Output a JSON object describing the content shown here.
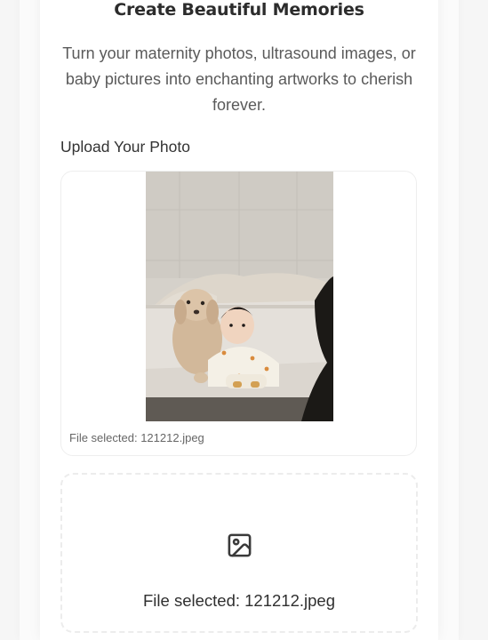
{
  "header": {
    "title": "Create Beautiful Memories",
    "subtitle": "Turn your maternity photos, ultrasound images, or baby pictures into enchanting artworks to cherish forever."
  },
  "upload": {
    "label": "Upload Your Photo",
    "preview_file_note": "File selected: 121212.jpeg",
    "dropzone_icon": "image-icon",
    "dropzone_file_note": "File selected: 121212.jpeg"
  }
}
